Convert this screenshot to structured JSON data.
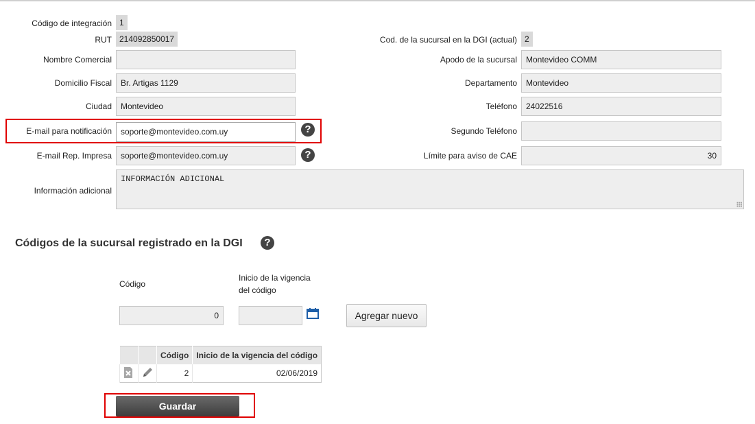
{
  "form": {
    "codigo_integracion": {
      "label": "Código de integración",
      "value": "1"
    },
    "rut": {
      "label": "RUT",
      "value": "214092850017"
    },
    "cod_sucursal_dgi": {
      "label": "Cod. de la sucursal en la DGI (actual)",
      "value": "2"
    },
    "nombre_comercial": {
      "label": "Nombre Comercial",
      "value": ""
    },
    "apodo": {
      "label": "Apodo de la sucursal",
      "value": "Montevideo COMM"
    },
    "domicilio": {
      "label": "Domicilio Fiscal",
      "value": "Br. Artigas 1129"
    },
    "departamento": {
      "label": "Departamento",
      "value": "Montevideo"
    },
    "ciudad": {
      "label": "Ciudad",
      "value": "Montevideo"
    },
    "telefono": {
      "label": "Teléfono",
      "value": "24022516"
    },
    "email_notificacion": {
      "label": "E-mail para notificación",
      "value": "soporte@montevideo.com.uy"
    },
    "segundo_telefono": {
      "label": "Segundo Teléfono",
      "value": ""
    },
    "email_rep": {
      "label": "E-mail Rep. Impresa",
      "value": "soporte@montevideo.com.uy"
    },
    "limite_cae": {
      "label": "Límite para aviso de CAE",
      "value": "30"
    },
    "info_adicional": {
      "label": "Información adicional",
      "value": "INFORMACIÓN ADICIONAL"
    }
  },
  "dgi_section": {
    "title": "Códigos de la sucursal registrado en la DGI",
    "codigo_label": "Código",
    "inicio_label_line1": "Inicio de la vigencia",
    "inicio_label_line2": "del código",
    "codigo_value": "0",
    "inicio_value": "",
    "add_button": "Agregar nuevo",
    "table": {
      "headers": [
        "Código",
        "Inicio de la vigencia del código"
      ],
      "rows": [
        {
          "codigo": "2",
          "inicio": "02/06/2019"
        }
      ]
    }
  },
  "help_glyph": "?",
  "save_button": "Guardar",
  "icons": [
    "help-icon",
    "calendar-icon",
    "delete-icon",
    "edit-icon"
  ],
  "colors": {
    "highlight": "#e00000",
    "calendar": "#1f5fa8"
  }
}
